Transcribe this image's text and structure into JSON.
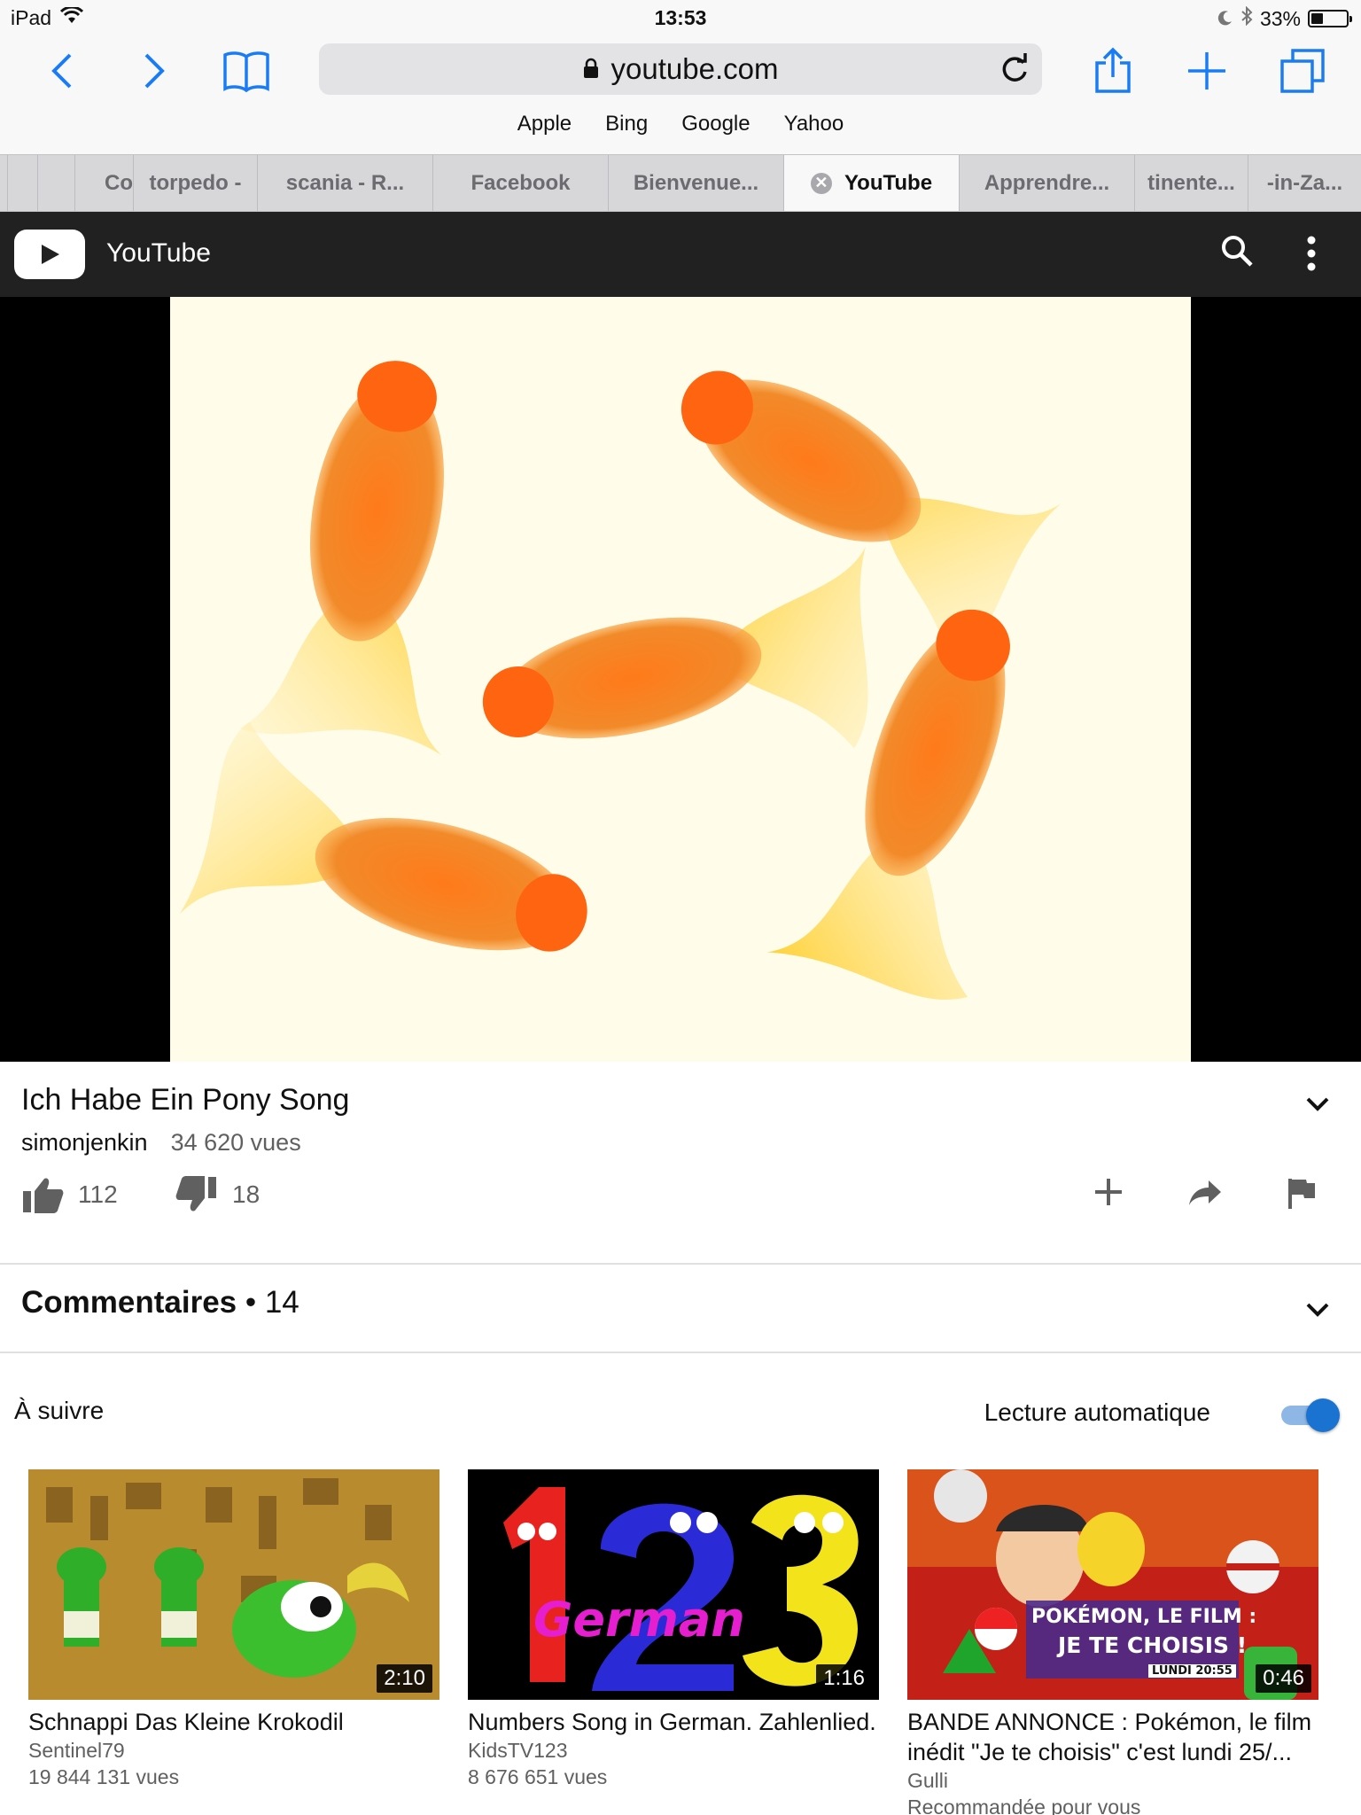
{
  "status": {
    "device": "iPad",
    "time": "13:53",
    "battery": "33%",
    "battery_level": 0.33
  },
  "browser": {
    "url": "youtube.com",
    "favorites": [
      "Apple",
      "Bing",
      "Google",
      "Yahoo"
    ],
    "tabs": [
      "Co",
      "torpedo -",
      "scania - R...",
      "Facebook",
      "Bienvenue...",
      "YouTube",
      "Apprendre...",
      "tinente...",
      "-in-Za..."
    ],
    "active_tab": "YouTube"
  },
  "youtube": {
    "title": "YouTube"
  },
  "video": {
    "title": "Ich Habe Ein Pony Song",
    "channel": "simonjenkin",
    "views": "34 620 vues",
    "likes": "112",
    "dislikes": "18"
  },
  "comments": {
    "label": "Commentaires",
    "count": "14"
  },
  "upnext": {
    "label": "À suivre",
    "autoplay_label": "Lecture automatique",
    "autoplay_on": true
  },
  "recommendations": [
    {
      "title": "Schnappi Das Kleine Krokodil",
      "channel": "Sentinel79",
      "views": "19 844 131 vues",
      "duration": "2:10"
    },
    {
      "title": "Numbers Song in German. Zahlenlied.",
      "channel": "KidsTV123",
      "views": "8 676 651 vues",
      "duration": "1:16",
      "thumb_text": "German"
    },
    {
      "title": "BANDE ANNONCE : Pokémon, le film inédit \"Je te choisis\" c'est lundi 25/...",
      "channel": "Gulli",
      "views": "Recommandée pour vous",
      "duration": "0:46",
      "thumb_line1": "POKÉMON, LE FILM :",
      "thumb_line2": "JE TE CHOISIS !",
      "thumb_line3": "LUNDI 20:55"
    }
  ],
  "colors": {
    "accent": "#1a73d1",
    "youtube_bar": "#212121",
    "browser_bg": "#f8f8f8",
    "safari_blue": "#1a7cf5"
  }
}
